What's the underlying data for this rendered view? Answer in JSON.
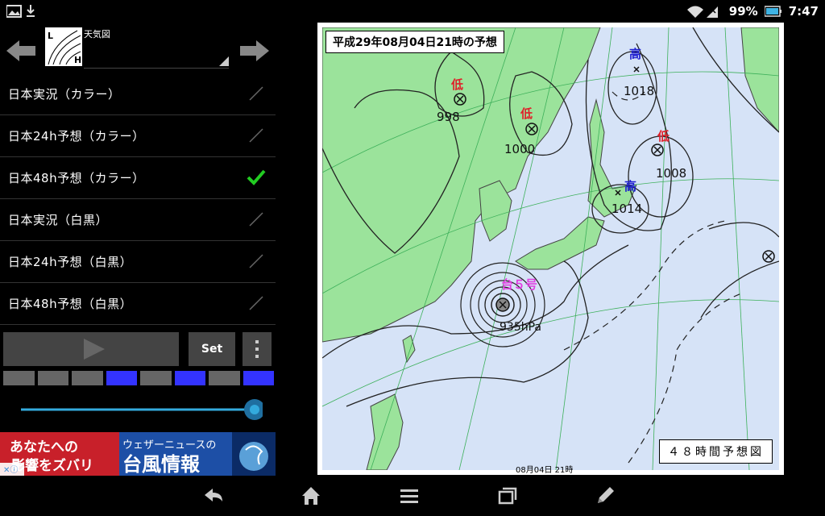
{
  "status_bar": {
    "battery": "99%",
    "time": "7:47",
    "icons": [
      "image-icon",
      "download-icon",
      "wifi-icon",
      "signal-icon",
      "battery-icon"
    ]
  },
  "map_selector": {
    "label": "天気図",
    "thumb_letters": [
      "L",
      "H"
    ]
  },
  "menu": [
    {
      "label": "日本実況（カラー）",
      "checked": false
    },
    {
      "label": "日本24h予想（カラー）",
      "checked": false
    },
    {
      "label": "日本48h予想（カラー）",
      "checked": true
    },
    {
      "label": "日本実況（白黒）",
      "checked": false
    },
    {
      "label": "日本24h予想（白黒）",
      "checked": false
    },
    {
      "label": "日本48h予想（白黒）",
      "checked": false
    }
  ],
  "controls": {
    "set_label": "Set",
    "frames": [
      false,
      false,
      false,
      true,
      false,
      true,
      false,
      true
    ],
    "slider_value": 1.0
  },
  "ad": {
    "line1": "あなたへの",
    "line2": "影響をズバリ",
    "brand": "ウェザーニュースの",
    "headline": "台風情報"
  },
  "map": {
    "title": "平成29年08月04日21時の予想",
    "box_label": "４８時間予想図",
    "date_footer": "08月04日 21時",
    "low_label": "低",
    "high_label": "高",
    "typhoon_label": "台５号",
    "pressures": {
      "low1": "998",
      "low2": "1000",
      "high1": "1018",
      "low3": "1008",
      "high2": "1014",
      "typhoon": "935hPa"
    },
    "colors": {
      "land": "#9be39b",
      "sea": "#d6e3f7",
      "low": "#e0202a",
      "high": "#1f1fd0",
      "typhoon": "#e040e0"
    }
  }
}
